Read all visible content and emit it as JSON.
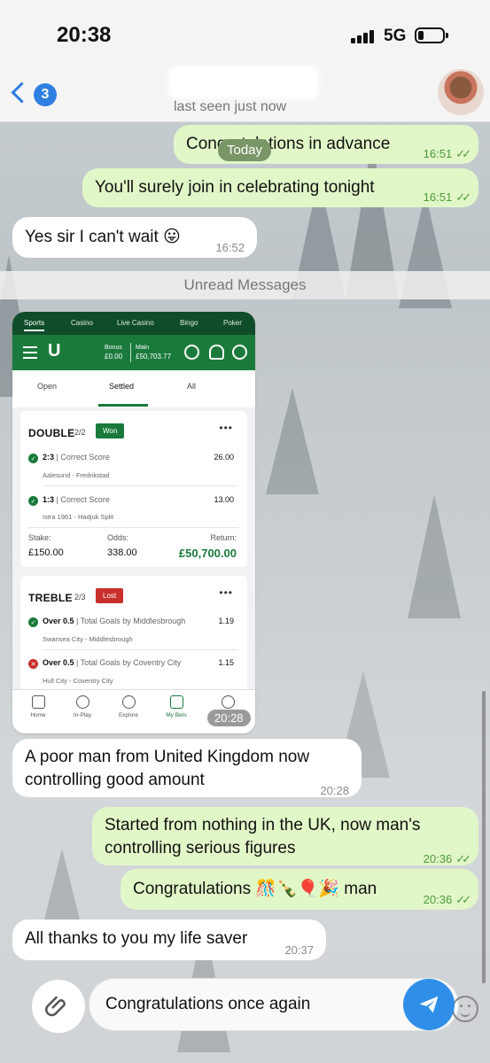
{
  "status_bar": {
    "time": "20:38",
    "network": "5G"
  },
  "header": {
    "back_count": "3",
    "last_seen": "last seen just now"
  },
  "date_separator": "Today",
  "unread_separator": "Unread Messages",
  "messages": [
    {
      "direction": "out",
      "text": "Congratulations in advance",
      "time": "16:51",
      "read": true
    },
    {
      "direction": "out",
      "text": "You'll surely join in celebrating tonight",
      "time": "16:51",
      "read": true
    },
    {
      "direction": "in",
      "text": "Yes sir I can't wait 😛",
      "time": "16:52"
    },
    {
      "direction": "in",
      "type": "image",
      "time": "20:28"
    },
    {
      "direction": "in",
      "text": "A poor man from United Kingdom now controlling good amount",
      "time": "20:28"
    },
    {
      "direction": "out",
      "text": "Started from nothing in the UK, now man's controlling serious figures",
      "time": "20:36",
      "read": true
    },
    {
      "direction": "out",
      "text": "Congratulations 🎊🍾🎈🎉 man",
      "time": "20:36",
      "read": true
    },
    {
      "direction": "in",
      "text": "All thanks to you my life saver",
      "time": "20:37"
    }
  ],
  "bet_screenshot": {
    "top_tabs": [
      "Sports",
      "Casino",
      "Live Casino",
      "Bingo",
      "Poker"
    ],
    "logo": "U",
    "bonus_label": "Bonus",
    "bonus_value": "£0.00",
    "main_label": "Main",
    "main_value": "£50,703.77",
    "sub_tabs": [
      "Open",
      "Settled",
      "All"
    ],
    "bets": [
      {
        "title": "DOUBLE",
        "count": "2/2",
        "status": "Won",
        "legs": [
          {
            "selection": "2:3",
            "market": "| Correct Score",
            "event": "Aalesund - Fredrikstad",
            "odds": "26.00",
            "result": "won"
          },
          {
            "selection": "1:3",
            "market": "| Correct Score",
            "event": "Istra 1961 - Hadjuk Split",
            "odds": "13.00",
            "result": "won"
          }
        ],
        "stake_label": "Stake:",
        "stake": "£150.00",
        "odds_label": "Odds:",
        "odds": "338.00",
        "return_label": "Return:",
        "return": "£50,700.00"
      },
      {
        "title": "TREBLE",
        "count": "2/3",
        "status": "Lost",
        "legs": [
          {
            "selection": "Over 0.5",
            "market": "| Total Goals by Middlesbrough",
            "event": "Swansea City - Middlesbrough",
            "odds": "1.19",
            "result": "won"
          },
          {
            "selection": "Over 0.5",
            "market": "| Total Goals by Coventry City",
            "event": "Hull City - Coventry City",
            "odds": "1.15",
            "result": "lost"
          }
        ]
      }
    ],
    "nav": [
      "Home",
      "In-Play",
      "Explore",
      "My Bets"
    ]
  },
  "composer": {
    "value": "Congratulations once again"
  },
  "colors": {
    "outgoing_bubble": "#e2f7c8",
    "incoming_bubble": "#ffffff",
    "accent_blue": "#2f8fe8",
    "brand_green": "#1a7a3b"
  },
  "icons": [
    "back-chevron-icon",
    "attach-paperclip-icon",
    "emoji-icon",
    "send-icon",
    "check-icon",
    "cross-icon"
  ]
}
